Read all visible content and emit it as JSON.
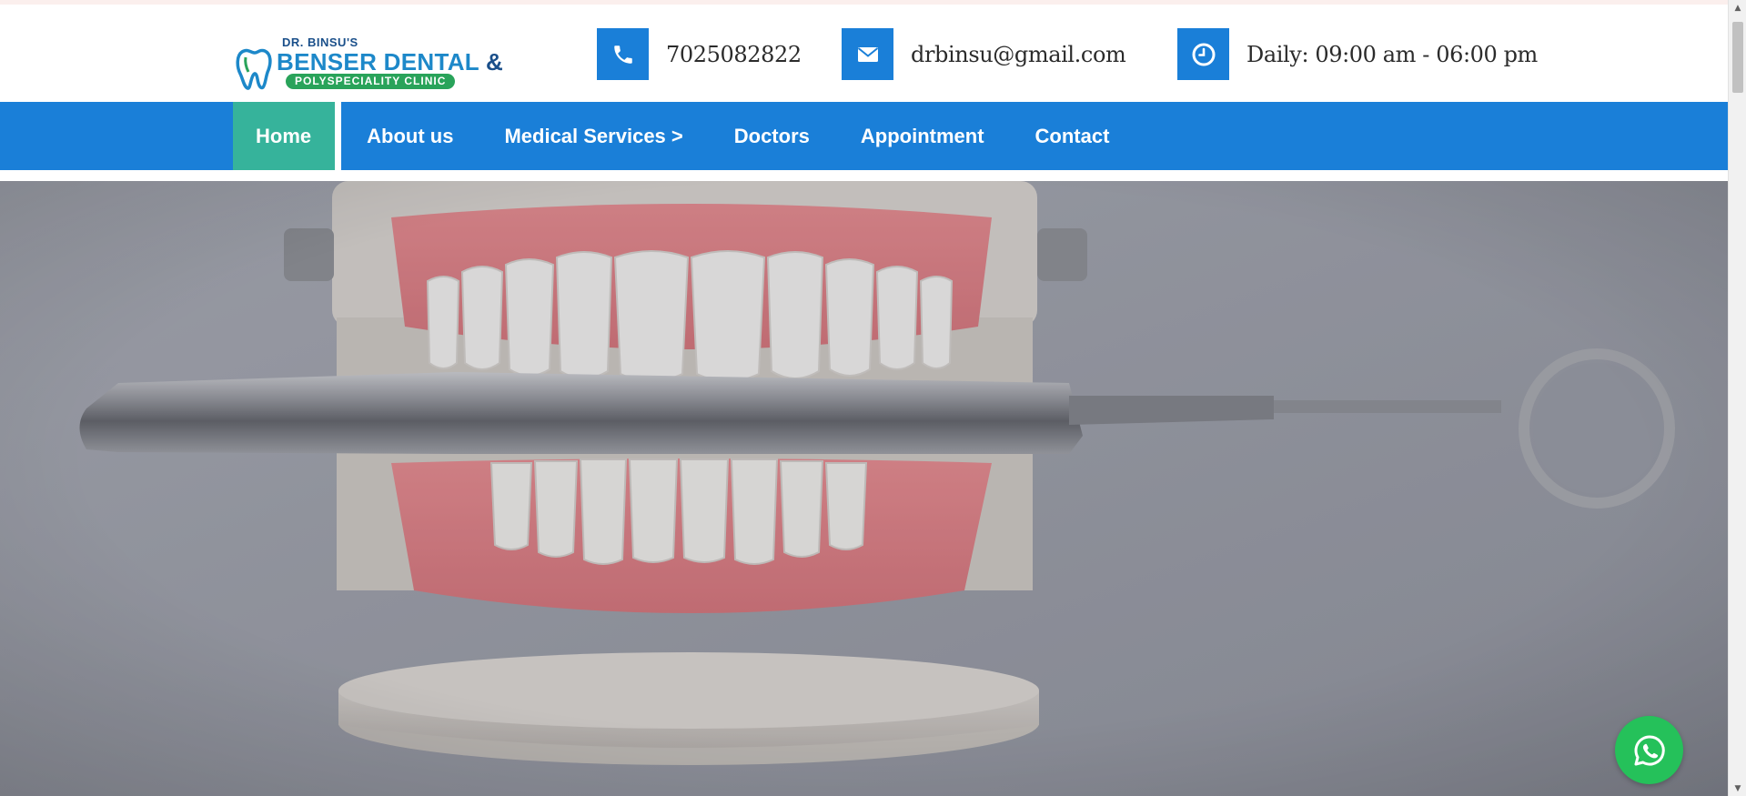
{
  "header": {
    "logo": {
      "line1": "DR. BINSU'S",
      "line2": "BENSER DENTAL",
      "ampersand": "&",
      "line3": "POLYSPECIALITY  CLINIC"
    },
    "phone": "7025082822",
    "email": "drbinsu@gmail.com",
    "hours": "Daily: 09:00 am - 06:00 pm"
  },
  "nav": {
    "items": [
      {
        "label": "Home",
        "active": true
      },
      {
        "label": "About us"
      },
      {
        "label": "Medical Services >"
      },
      {
        "label": "Doctors"
      },
      {
        "label": "Appointment"
      },
      {
        "label": "Contact"
      }
    ]
  },
  "icons": {
    "phone": "phone-icon",
    "email": "envelope-icon",
    "hours": "clock-icon",
    "whatsapp": "whatsapp-icon"
  },
  "colors": {
    "primary": "#1a7fd8",
    "active_nav": "#36b39b",
    "whatsapp": "#25c15a",
    "logo_blue": "#1d88c9",
    "logo_green": "#29a35a"
  }
}
